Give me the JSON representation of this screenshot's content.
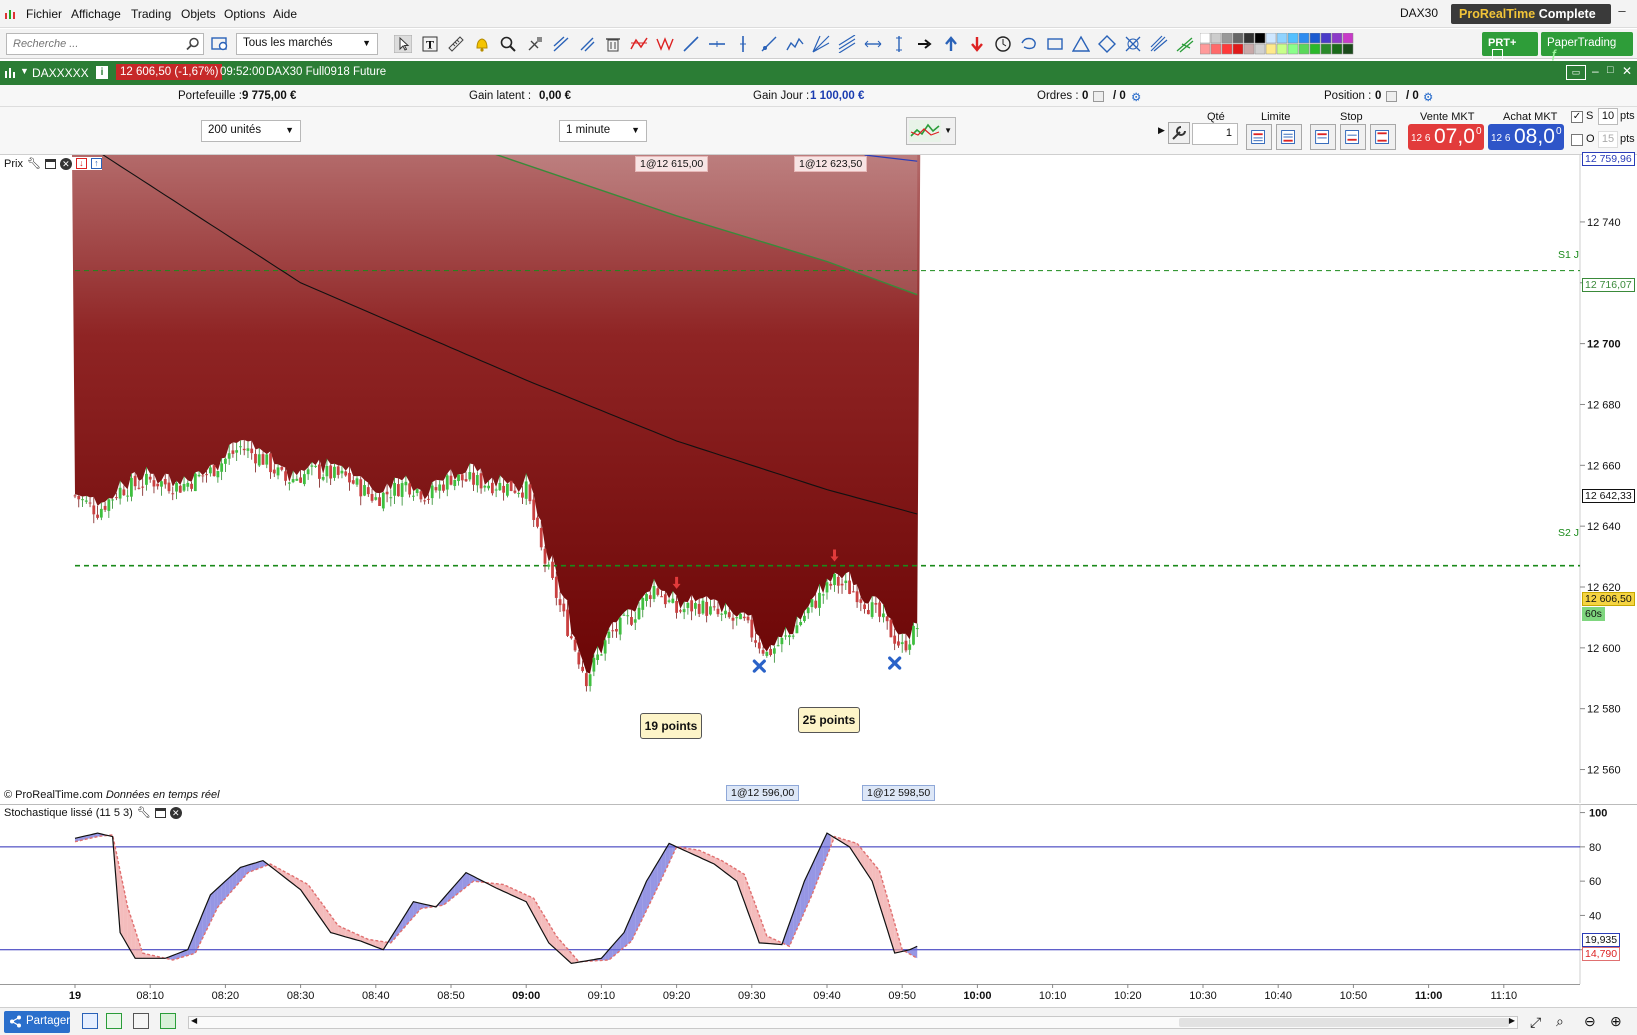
{
  "menu": {
    "items": [
      "Fichier",
      "Affichage",
      "Trading",
      "Objets",
      "Options",
      "Aide"
    ],
    "ticker": "DAX30",
    "brand_a": "ProRealTime",
    "brand_b": "Complete"
  },
  "toolbar": {
    "search_placeholder": "Recherche ...",
    "market_select": "Tous les marchés",
    "prt_plus_label": "PRT+",
    "paper_label": "PaperTrading"
  },
  "chart_window": {
    "instrument": "DAXXXXX",
    "price_change": "12 606,50 (-1,67%)",
    "time": "09:52:00",
    "contract": "DAX30 Full0918 Future"
  },
  "portfolio": {
    "portefeuille_label": "Portefeuille :",
    "portefeuille_value": "9 775,00 €",
    "gain_latent_label": "Gain latent :",
    "gain_latent_value": "0,00 €",
    "gain_jour_label": "Gain Jour :",
    "gain_jour_value": "1 100,00 €",
    "ordres_label": "Ordres :",
    "ordres_a": "0",
    "ordres_b": "/ 0",
    "position_label": "Position :",
    "position_a": "0",
    "position_b": "/ 0"
  },
  "controls": {
    "units": "200 unités",
    "timeframe": "1 minute"
  },
  "order_panel": {
    "qty_label": "Qté",
    "qty_value": "1",
    "limit_label": "Limite",
    "stop_label": "Stop",
    "sell_label": "Vente MKT",
    "buy_label": "Achat MKT",
    "sell_prefix": "12 6",
    "sell_big": "07,0",
    "sell_sup": "0",
    "buy_prefix": "12 6",
    "buy_big": "08,0",
    "buy_sup": "0",
    "s_label": "S",
    "s_value": "10",
    "o_label": "O",
    "o_value": "15",
    "pts": "pts"
  },
  "price_panel": {
    "title": "Prix",
    "credit": "© ProRealTime.com",
    "credit_rt": "Données en temps réel",
    "tag_top_1": "1@12 615,00",
    "tag_top_2": "1@12 623,50",
    "tag_bot_1": "1@12 596,00",
    "tag_bot_2": "1@12 598,50",
    "note_1": "19 points",
    "note_2": "25 points",
    "s1_label": "S1 J",
    "s2_label": "S2 J",
    "price_labels": {
      "top": "12 759,96",
      "green": "12 716,07",
      "mid": "12 642,33",
      "last": "12 606,50",
      "countdown": "60s"
    }
  },
  "stoch_panel": {
    "title": "Stochastique lissé (11 5 3)",
    "label_blue": "19,935",
    "label_red": "14,790"
  },
  "bottom": {
    "share_label": "Partager"
  },
  "chart_data": [
    {
      "type": "candlestick",
      "title": "DAX30 Full0918 Future",
      "timeframe": "1 minute",
      "y_ticks": [
        12740,
        12720,
        12700,
        12680,
        12660,
        12640,
        12620,
        12600,
        12580,
        12560
      ],
      "y_tick_labels": [
        "12 740",
        "12 720",
        "12 700",
        "12 680",
        "12 660",
        "12 640",
        "12 620",
        "12 600",
        "12 580",
        "12 560"
      ],
      "ylim": [
        12549,
        12762
      ],
      "x_ticks": [
        "19",
        "08:10",
        "08:20",
        "08:30",
        "08:40",
        "08:50",
        "09:00",
        "09:10",
        "09:20",
        "09:30",
        "09:40",
        "09:50",
        "10:00",
        "10:10",
        "10:20",
        "10:30",
        "10:40",
        "10:50",
        "11:00",
        "11:10"
      ],
      "x_ticks_bold": [
        "19",
        "09:00",
        "10:00",
        "11:00"
      ],
      "close_anchor_points": [
        [
          "08:00",
          12650
        ],
        [
          "08:03",
          12645
        ],
        [
          "08:06",
          12652
        ],
        [
          "08:10",
          12655
        ],
        [
          "08:14",
          12653
        ],
        [
          "08:18",
          12658
        ],
        [
          "08:22",
          12666
        ],
        [
          "08:25",
          12662
        ],
        [
          "08:28",
          12655
        ],
        [
          "08:32",
          12658
        ],
        [
          "08:36",
          12656
        ],
        [
          "08:40",
          12649
        ],
        [
          "08:44",
          12654
        ],
        [
          "08:47",
          12650
        ],
        [
          "08:50",
          12656
        ],
        [
          "08:55",
          12654
        ],
        [
          "09:00",
          12652
        ],
        [
          "09:02",
          12632
        ],
        [
          "09:05",
          12610
        ],
        [
          "09:08",
          12590
        ],
        [
          "09:11",
          12604
        ],
        [
          "09:14",
          12610
        ],
        [
          "09:17",
          12620
        ],
        [
          "09:20",
          12612
        ],
        [
          "09:23",
          12614
        ],
        [
          "09:26",
          12610
        ],
        [
          "09:29",
          12608
        ],
        [
          "09:32",
          12598
        ],
        [
          "09:35",
          12604
        ],
        [
          "09:38",
          12614
        ],
        [
          "09:41",
          12622
        ],
        [
          "09:44",
          12618
        ],
        [
          "09:47",
          12610
        ],
        [
          "09:50",
          12600
        ],
        [
          "09:52",
          12606.5
        ]
      ],
      "ma_black": [
        [
          "08:00",
          12768
        ],
        [
          "08:30",
          12720
        ],
        [
          "09:00",
          12688
        ],
        [
          "09:20",
          12668
        ],
        [
          "09:40",
          12652
        ],
        [
          "09:52",
          12644
        ]
      ],
      "ma_green": [
        [
          "08:55",
          12763
        ],
        [
          "09:20",
          12742
        ],
        [
          "09:40",
          12727
        ],
        [
          "09:52",
          12716.07
        ]
      ],
      "levels": [
        {
          "name": "S1 J",
          "value": 12724
        },
        {
          "name": "S2 J",
          "value": 12627
        }
      ],
      "markers": [
        {
          "type": "sell-arrow",
          "time": "09:20",
          "value": 12622
        },
        {
          "type": "sell-arrow",
          "time": "09:41",
          "value": 12631
        },
        {
          "type": "cross",
          "time": "09:31",
          "value": 12594
        },
        {
          "type": "cross",
          "time": "09:49",
          "value": 12595
        }
      ]
    },
    {
      "type": "line",
      "title": "Stochastique lissé (11 5 3)",
      "y_ticks": [
        100,
        80,
        60,
        40,
        20
      ],
      "ylim": [
        0,
        105
      ],
      "levels": [
        80,
        20
      ],
      "series": [
        {
          "values_at": [
            [
              "08:00",
              85
            ],
            [
              "08:03",
              88
            ],
            [
              "08:05",
              86
            ],
            [
              "08:06",
              30
            ],
            [
              "08:08",
              15
            ],
            [
              "08:12",
              15
            ],
            [
              "08:15",
              20
            ],
            [
              "08:18",
              52
            ],
            [
              "08:22",
              68
            ],
            [
              "08:25",
              72
            ],
            [
              "08:30",
              55
            ],
            [
              "08:34",
              30
            ],
            [
              "08:38",
              25
            ],
            [
              "08:41",
              20
            ],
            [
              "08:45",
              48
            ],
            [
              "08:48",
              45
            ],
            [
              "08:52",
              65
            ],
            [
              "08:56",
              56
            ],
            [
              "09:00",
              48
            ],
            [
              "09:03",
              24
            ],
            [
              "09:06",
              12
            ],
            [
              "09:10",
              15
            ],
            [
              "09:13",
              30
            ],
            [
              "09:16",
              60
            ],
            [
              "09:19",
              82
            ],
            [
              "09:22",
              76
            ],
            [
              "09:25",
              70
            ],
            [
              "09:28",
              60
            ],
            [
              "09:31",
              24
            ],
            [
              "09:34",
              23
            ],
            [
              "09:37",
              60
            ],
            [
              "09:40",
              88
            ],
            [
              "09:43",
              80
            ],
            [
              "09:46",
              60
            ],
            [
              "09:49",
              18
            ],
            [
              "09:51",
              20
            ],
            [
              "09:52",
              22
            ]
          ]
        },
        {
          "values_at": [
            [
              "08:00",
              83
            ],
            [
              "08:03",
              86
            ],
            [
              "08:05",
              87
            ],
            [
              "08:07",
              45
            ],
            [
              "08:09",
              18
            ],
            [
              "08:13",
              14
            ],
            [
              "08:16",
              18
            ],
            [
              "08:19",
              45
            ],
            [
              "08:23",
              65
            ],
            [
              "08:26",
              70
            ],
            [
              "08:31",
              58
            ],
            [
              "08:35",
              34
            ],
            [
              "08:39",
              26
            ],
            [
              "08:42",
              24
            ],
            [
              "08:46",
              44
            ],
            [
              "08:49",
              46
            ],
            [
              "08:53",
              60
            ],
            [
              "08:57",
              58
            ],
            [
              "09:01",
              50
            ],
            [
              "09:04",
              28
            ],
            [
              "09:07",
              13
            ],
            [
              "09:11",
              14
            ],
            [
              "09:14",
              25
            ],
            [
              "09:17",
              52
            ],
            [
              "09:20",
              80
            ],
            [
              "09:23",
              78
            ],
            [
              "09:26",
              72
            ],
            [
              "09:29",
              64
            ],
            [
              "09:32",
              28
            ],
            [
              "09:35",
              22
            ],
            [
              "09:38",
              52
            ],
            [
              "09:41",
              86
            ],
            [
              "09:44",
              82
            ],
            [
              "09:47",
              66
            ],
            [
              "09:50",
              20
            ],
            [
              "09:52",
              15
            ]
          ]
        }
      ]
    }
  ],
  "colors": {
    "titlebar_green": "#2b7d35",
    "area_red_dark": "#7a0c0c",
    "area_red_light": "#b36a6a",
    "candle_up": "#3fbf3f",
    "candle_down": "#c94040",
    "level_green": "#1a8a1a",
    "stoch_blue": "#1a1a8a",
    "stoch_red": "#e07070",
    "sell": "#e23b3b",
    "buy": "#2e55c8"
  },
  "icons": [
    "app-logo-icon",
    "search-icon",
    "cursor-icon",
    "text-icon",
    "ruler-icon",
    "alert-icon",
    "zoom-icon",
    "trendline-icon",
    "fibonacci-icon",
    "trash-icon",
    "arrow-right-icon",
    "arrow-up-icon",
    "arrow-down-icon",
    "share-icon",
    "gear-icon",
    "close-icon",
    "wrench-icon"
  ]
}
